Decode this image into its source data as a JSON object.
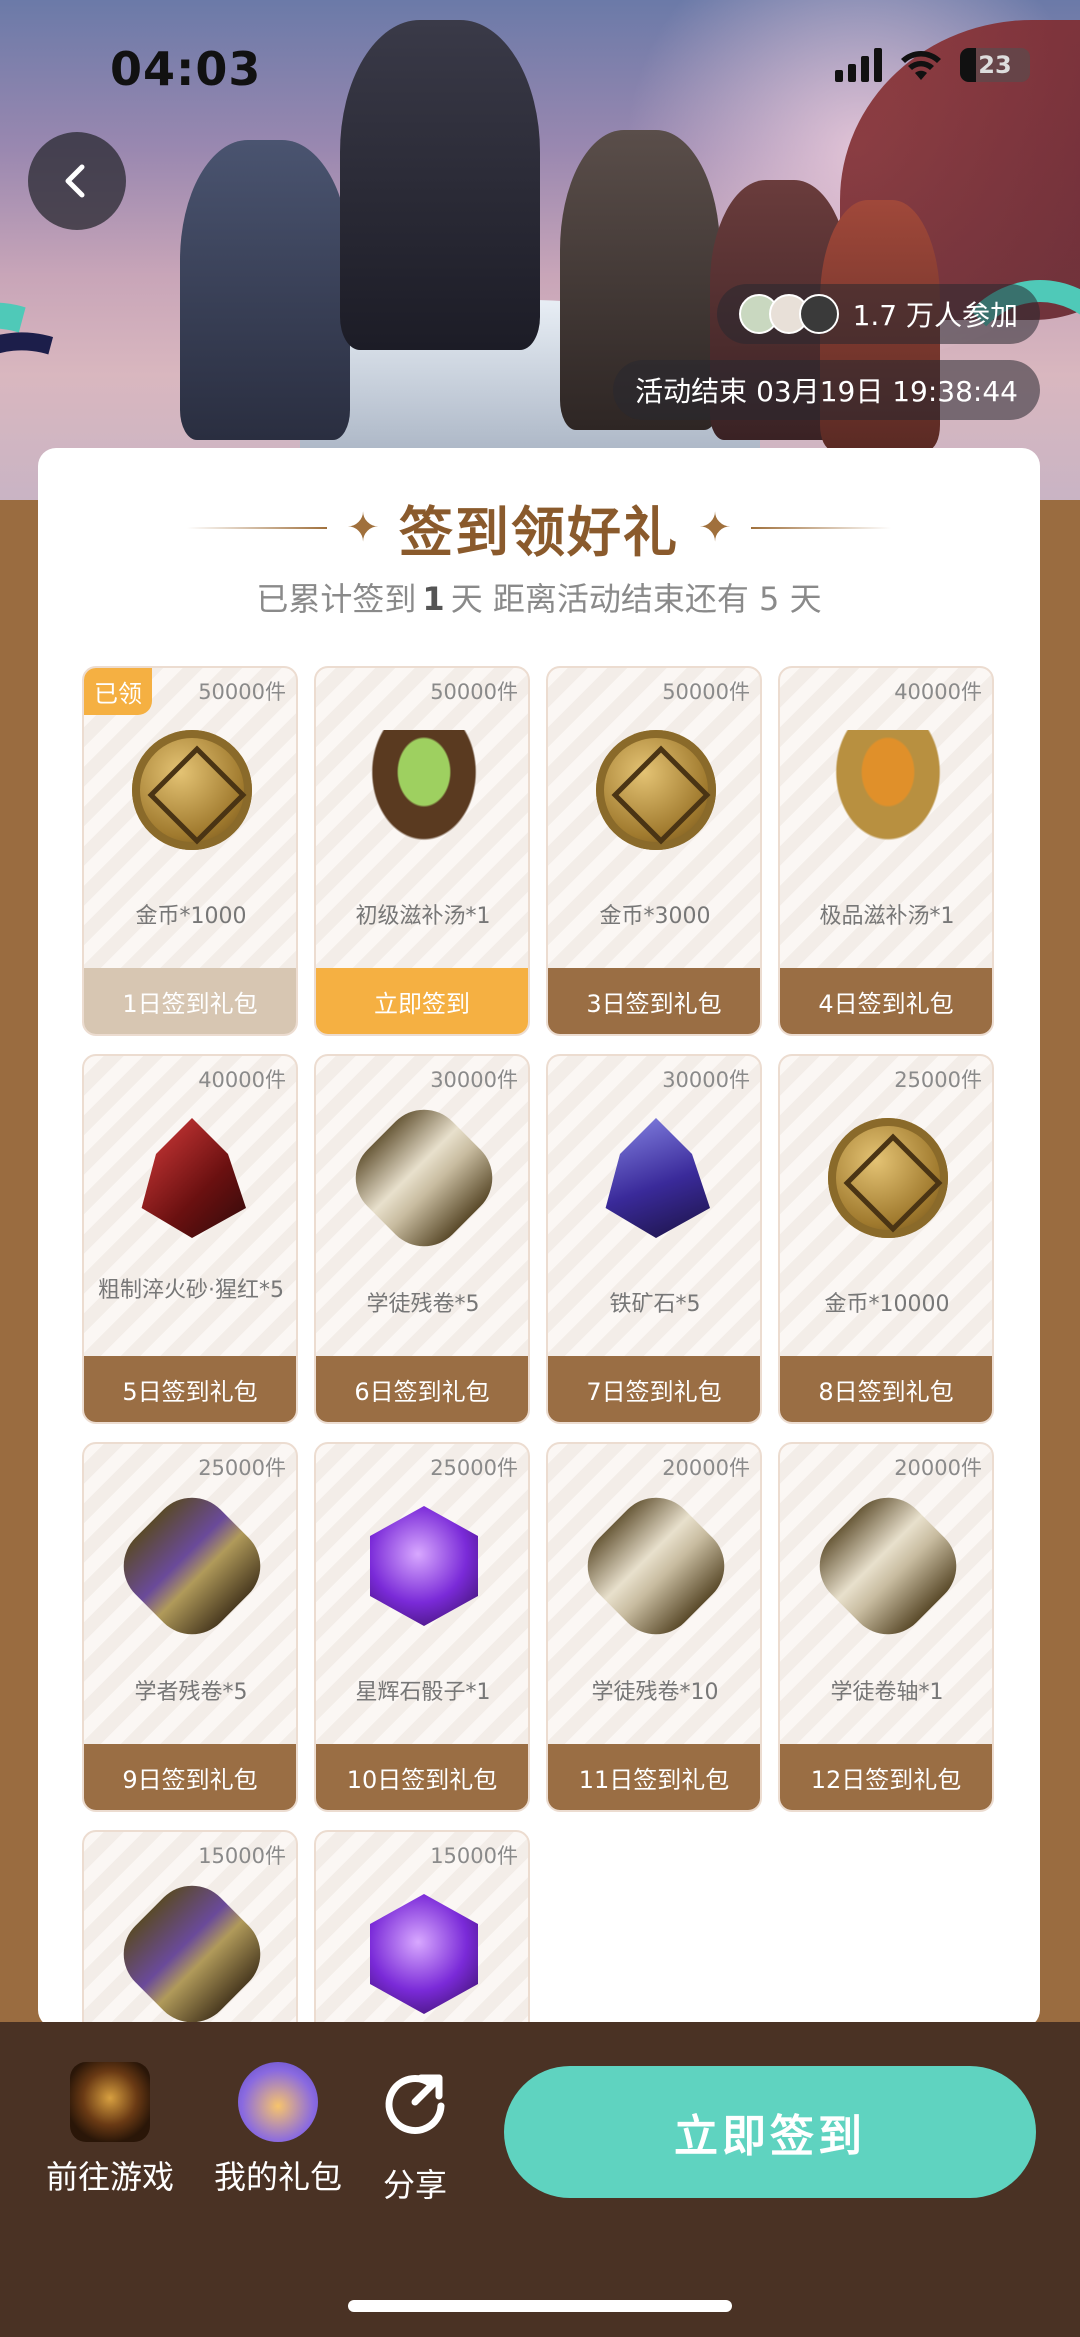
{
  "status": {
    "time": "04:03",
    "battery": "23"
  },
  "hero": {
    "participants": "1.7 万人参加",
    "countdown": "活动结束 03月19日 19:38:44"
  },
  "card": {
    "title": "签到领好礼",
    "subtitle_prefix": "已累计签到",
    "subtitle_days": "1",
    "subtitle_mid": "天  距离活动结束还有 5 天"
  },
  "rewards": [
    {
      "count": "50000件",
      "name": "金币*1000",
      "button": "1日签到礼包",
      "tag": "已领",
      "state": "claimed",
      "icon": "gold-coin-icon"
    },
    {
      "count": "50000件",
      "name": "初级滋补汤*1",
      "button": "立即签到",
      "state": "active",
      "icon": "green-soup-bowl-icon"
    },
    {
      "count": "50000件",
      "name": "金币*3000",
      "button": "3日签到礼包",
      "state": "locked",
      "icon": "gold-coin-icon"
    },
    {
      "count": "40000件",
      "name": "极品滋补汤*1",
      "button": "4日签到礼包",
      "state": "locked",
      "icon": "golden-soup-bowl-icon"
    },
    {
      "count": "40000件",
      "name": "粗制淬火砂·猩红*5",
      "button": "5日签到礼包",
      "state": "locked",
      "icon": "red-crystal-icon"
    },
    {
      "count": "30000件",
      "name": "学徒残卷*5",
      "button": "6日签到礼包",
      "state": "locked",
      "icon": "scroll-fragment-icon"
    },
    {
      "count": "30000件",
      "name": "铁矿石*5",
      "button": "7日签到礼包",
      "state": "locked",
      "icon": "blue-crystal-icon"
    },
    {
      "count": "25000件",
      "name": "金币*10000",
      "button": "8日签到礼包",
      "state": "locked",
      "icon": "gold-coin-icon"
    },
    {
      "count": "25000件",
      "name": "学者残卷*5",
      "button": "9日签到礼包",
      "state": "locked",
      "icon": "purple-scroll-fragment-icon"
    },
    {
      "count": "25000件",
      "name": "星辉石骰子*1",
      "button": "10日签到礼包",
      "state": "locked",
      "icon": "purple-dice-icon"
    },
    {
      "count": "20000件",
      "name": "学徒残卷*10",
      "button": "11日签到礼包",
      "state": "locked",
      "icon": "scroll-fragment-icon"
    },
    {
      "count": "20000件",
      "name": "学徒卷轴*1",
      "button": "12日签到礼包",
      "state": "locked",
      "icon": "scroll-icon"
    },
    {
      "count": "15000件",
      "name": "",
      "button": "",
      "state": "locked",
      "icon": "purple-scroll-fragment-icon"
    },
    {
      "count": "15000件",
      "name": "",
      "button": "",
      "state": "locked",
      "icon": "purple-dice-icon"
    }
  ],
  "bottom_bar": {
    "game_label": "前往游戏",
    "gift_label": "我的礼包",
    "share_label": "分享",
    "signin_label": "立即签到"
  },
  "colors": {
    "accent": "#5fd3c0",
    "brown": "#9a6e44",
    "gold": "#f5b042",
    "title": "#8a5a2c"
  }
}
